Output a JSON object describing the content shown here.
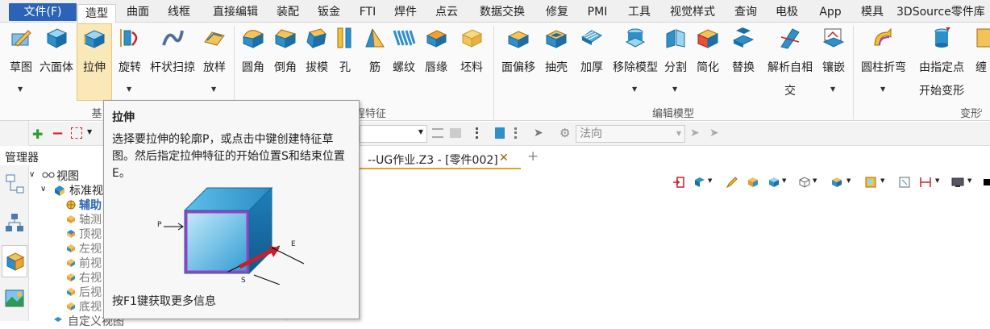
{
  "menubar": {
    "file": "文件(F)",
    "items": [
      "造型",
      "曲面",
      "线框",
      "直接编辑",
      "装配",
      "钣金",
      "FTI",
      "焊件",
      "点云",
      "数据交换",
      "修复",
      "PMI",
      "工具",
      "视觉样式",
      "查询",
      "电极",
      "App",
      "模具",
      "3DSource零件库"
    ]
  },
  "ribbon": {
    "tools": [
      {
        "label": "草图",
        "icon": "sketch-icon"
      },
      {
        "label": "六面体",
        "icon": "hexahedron-icon"
      },
      {
        "label": "拉伸",
        "icon": "extrude-icon"
      },
      {
        "label": "旋转",
        "icon": "revolve-icon"
      },
      {
        "label": "杆状扫掠",
        "icon": "rod-sweep-icon"
      },
      {
        "label": "放样",
        "icon": "loft-icon"
      },
      {
        "label": "圆角",
        "icon": "fillet-icon"
      },
      {
        "label": "倒角",
        "icon": "chamfer-icon"
      },
      {
        "label": "拔模",
        "icon": "draft-icon"
      },
      {
        "label": "孔",
        "icon": "hole-icon"
      },
      {
        "label": "筋",
        "icon": "rib-icon"
      },
      {
        "label": "螺纹",
        "icon": "thread-icon"
      },
      {
        "label": "唇缘",
        "icon": "lip-icon"
      },
      {
        "label": "坯料",
        "icon": "stock-icon"
      },
      {
        "label": "面偏移",
        "icon": "face-offset-icon"
      },
      {
        "label": "抽壳",
        "icon": "shell-icon"
      },
      {
        "label": "加厚",
        "icon": "thicken-icon"
      },
      {
        "label": "移除模型",
        "icon": "remove-model-icon"
      },
      {
        "label": "分割",
        "icon": "split-icon"
      },
      {
        "label": "简化",
        "icon": "simplify-icon"
      },
      {
        "label": "替换",
        "icon": "replace-icon"
      },
      {
        "label": "解析自相",
        "label2": "交",
        "icon": "self-intersect-icon"
      },
      {
        "label": "镶嵌",
        "icon": "inlay-icon"
      },
      {
        "label": "圆柱折弯",
        "icon": "cylinder-bend-icon"
      },
      {
        "label": "由指定点",
        "label2": "开始变形",
        "icon": "deform-point-icon"
      },
      {
        "label": "缠",
        "icon": "wrap-icon"
      }
    ],
    "groups": {
      "basic": "基",
      "feature": "程特征",
      "edit": "编辑模型",
      "deform": "变形"
    }
  },
  "toolbar": {
    "direction_label": "法向"
  },
  "manager": {
    "title": "管理器"
  },
  "tab": {
    "title": "--UG作业.Z3 - [零件002]",
    "close": "✕",
    "add": "+"
  },
  "tree": {
    "root": "视图",
    "standard": "标准视",
    "items": [
      "辅助",
      "轴测",
      "顶视",
      "左视",
      "前视",
      "右视",
      "后视",
      "底视"
    ],
    "custom": "自定义视图"
  },
  "tooltip": {
    "title": "拉伸",
    "body": "选择要拉伸的轮廓P，或点击中键创建特征草图。然后指定拉伸特征的开始位置S和结束位置E。",
    "label_p": "P",
    "label_e": "E",
    "label_s": "S",
    "footer": "按F1键获取更多信息"
  },
  "colors": {
    "accent": "#2a63b8",
    "selected": "#fbe8b8",
    "cube_face": "#3aa8d8",
    "profile": "#9b3fc8",
    "arrow": "#c8202a"
  }
}
